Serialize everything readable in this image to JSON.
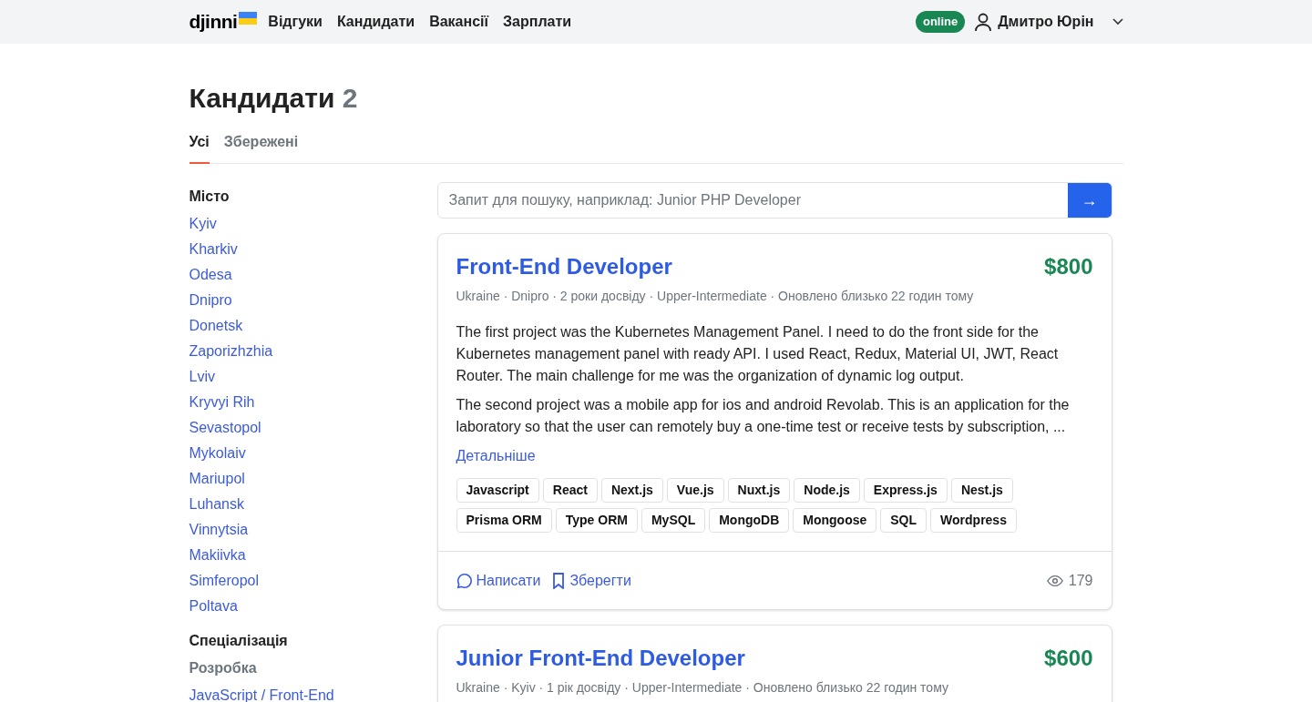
{
  "header": {
    "logo": "djinni",
    "nav": [
      "Відгуки",
      "Кандидати",
      "Вакансії",
      "Зарплати"
    ],
    "status_badge": "online",
    "user": "Дмитро Юрін"
  },
  "page": {
    "title": "Кандидати",
    "count": "2"
  },
  "tabs": [
    {
      "label": "Усі",
      "selected": true
    },
    {
      "label": "Збережені",
      "selected": false
    }
  ],
  "sidebar": {
    "city_heading": "Місто",
    "cities": [
      "Kyiv",
      "Kharkiv",
      "Odesa",
      "Dnipro",
      "Donetsk",
      "Zaporizhzhia",
      "Lviv",
      "Kryvyi Rih",
      "Sevastopol",
      "Mykolaiv",
      "Mariupol",
      "Luhansk",
      "Vinnytsia",
      "Makiivka",
      "Simferopol",
      "Poltava"
    ],
    "spec_heading": "Спеціалізація",
    "spec_group": "Розробка",
    "specs": [
      "JavaScript / Front-End"
    ]
  },
  "search": {
    "placeholder": "Запит для пошуку, наприклад: Junior PHP Developer",
    "button": "→"
  },
  "candidates": [
    {
      "title": "Front-End Developer",
      "salary": "$800",
      "meta": "Ukraine · Dnipro · 2 роки досвіду · Upper-Intermediate · Оновлено близько 22 годин тому",
      "paragraphs": [
        "The first project was the Kubernetes Management Panel. I need to do the front side for the Kubernetes management panel with ready API. I used React, Redux, Material UI, JWT, React Router. The main challenge for me was the organization of dynamic log output.",
        "The second project was a mobile app for ios and android Revolab. This is an application for the laboratory so that the user can remotely buy a one-time test or receive tests by subscription, ..."
      ],
      "more": "Детальніше",
      "tags": [
        "Javascript",
        "React",
        "Next.js",
        "Vue.js",
        "Nuxt.js",
        "Node.js",
        "Express.js",
        "Nest.js",
        "Prisma ORM",
        "Type ORM",
        "MySQL",
        "MongoDB",
        "Mongoose",
        "SQL",
        "Wordpress"
      ],
      "write": "Написати",
      "save": "Зберегти",
      "views": "179"
    },
    {
      "title": "Junior Front-End Developer",
      "salary": "$600",
      "meta": "Ukraine · Kyiv · 1 рік досвіду · Upper-Intermediate · Оновлено близько 22 годин тому"
    }
  ]
}
